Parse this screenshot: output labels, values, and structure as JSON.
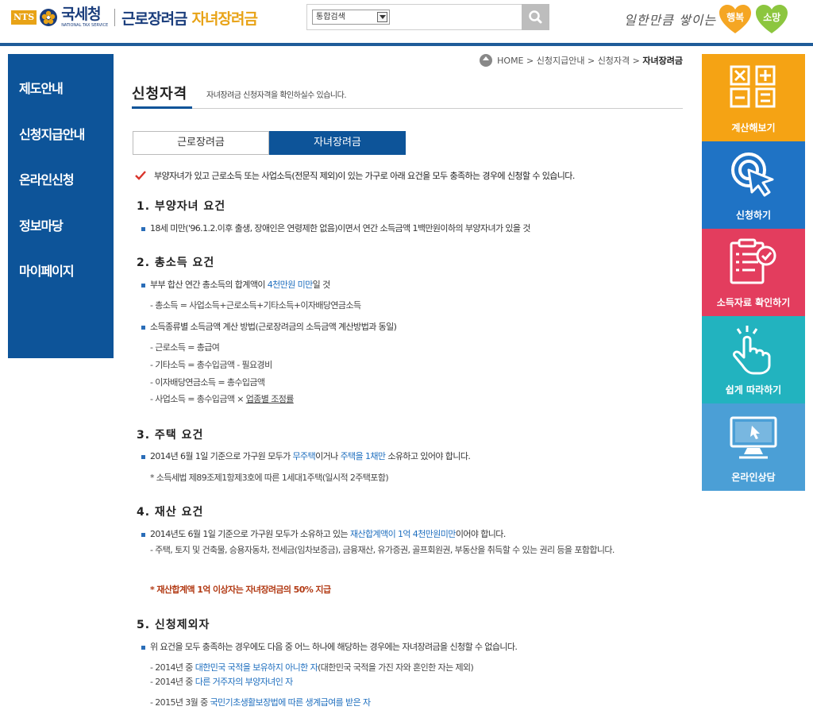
{
  "header": {
    "nts_badge": "NTS",
    "agency_kr": "국세청",
    "agency_en": "NATIONAL TAX SERVICE",
    "site_name_1": "근로장려금",
    "site_name_2": "자녀장려금",
    "search_select": "통합검색",
    "search_placeholder": "",
    "slogan": "일한만큼 쌓이는",
    "heart_1": "행복",
    "heart_2": "소망",
    "colors": {
      "navy": "#0d5499",
      "orange": "#e8a317",
      "heart1": "#f5a623",
      "heart2": "#8cc63f"
    }
  },
  "lnb": {
    "items": [
      "제도안내",
      "신청지급안내",
      "온라인신청",
      "정보마당",
      "마이페이지"
    ]
  },
  "quick": {
    "items": [
      {
        "label": "계산해보기",
        "icon": "calculator-icon",
        "color": "#f5a314"
      },
      {
        "label": "신청하기",
        "icon": "click-cursor-icon",
        "color": "#1f73c5"
      },
      {
        "label": "소득자료 확인하기",
        "icon": "checklist-icon",
        "color": "#e33d5e"
      },
      {
        "label": "쉽게 따라하기",
        "icon": "hand-tap-icon",
        "color": "#22b3bf"
      },
      {
        "label": "온라인상담",
        "icon": "monitor-icon",
        "color": "#4b9fd6"
      }
    ]
  },
  "breadcrumb": {
    "home": "HOME",
    "sep": ">",
    "items": [
      "신청지급안내",
      "신청자격"
    ],
    "current": "자녀장려금"
  },
  "page": {
    "title": "신청자격",
    "desc": "자녀장려금 신청자격을 확인하실수 있습니다."
  },
  "tabs": [
    "근로장려금",
    "자녀장려금"
  ],
  "intro": "부양자녀가 있고 근로소득 또는 사업소득(전문직 제외)이 있는 가구로 아래 요건을 모두 충족하는 경우에 신청할 수 있습니다.",
  "sections": {
    "s1": {
      "title": "1. 부양자녀 요건",
      "b1": "18세 미만('96.1.2.이후 출생, 장애인은 연령제한 없음)이면서 연간 소득금액 1백만원이하의 부양자녀가 있을 것"
    },
    "s2": {
      "title": "2. 총소득 요건",
      "b1_pre": "부부 합산 연간 총소득의 합계액이 ",
      "b1_hl": "4천만원 미만",
      "b1_post": "일 것",
      "d1": "- 총소득 = 사업소득+근로소득+기타소득+이자배당연금소득",
      "b2": "소득종류별 소득금액 계산 방법(근로장려금의 소득금액 계산방법과 동일)",
      "d2": "- 근로소득 = 총급여",
      "d3": "- 기타소득 = 총수입금액 - 필요경비",
      "d4": "- 이자배당연금소득 = 총수입금액",
      "d5_pre": "- 사업소득 = 총수입금액 × ",
      "d5_link": "업종별 조정률"
    },
    "s3": {
      "title": "3. 주택 요건",
      "b1_pre": "2014년 6월 1일 기준으로 가구원 모두가 ",
      "b1_hl1": "무주택",
      "b1_mid": "이거나 ",
      "b1_hl2": "주택을 1채만",
      "b1_post": " 소유하고 있어야 합니다.",
      "note": "* 소득세법 제89조제1항제3호에 따른 1세대1주택(일시적 2주택포함)"
    },
    "s4": {
      "title": "4. 재산 요건",
      "b1_pre": "2014년도 6월 1일 기준으로 가구원 모두가 소유하고 있는 ",
      "b1_hl": "재산합계액이 1억 4천만원미만",
      "b1_post": "이어야 합니다.",
      "d1": "- 주택, 토지 및 건축물, 승용자동차, 전세금(임차보증금), 금융재산, 유가증권, 골프회원권, 부동산을 취득할 수 있는 권리 등을 포함합니다.",
      "note": "* 재산합계액 1억 이상자는 자녀장려금의 50% 지급"
    },
    "s5": {
      "title": "5. 신청제외자",
      "b1": "위 요건을 모두 충족하는 경우에도 다음 중 어느 하나에 해당하는 경우에는 자녀장려금을 신청할 수 없습니다.",
      "d1_pre": "- 2014년 중 ",
      "d1_hl": "대한민국 국적을 보유하지 아니한 자",
      "d1_post": "(대한민국 국적을 가진 자와 혼인한 자는 제외)",
      "d2_pre": "- 2014년 중 ",
      "d2_hl": "다른 거주자의 부양자녀인 자",
      "d3_pre": "- 2015년 3월 중 ",
      "d3_hl": "국민기초생활보장법에 따른 생계급여를 받은 자"
    }
  }
}
